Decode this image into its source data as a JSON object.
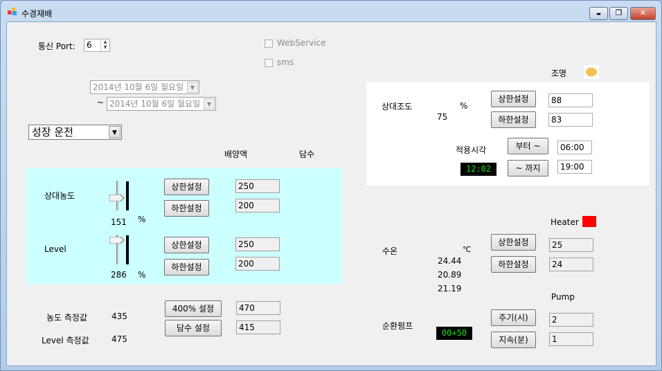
{
  "window": {
    "title": "수경재배",
    "minimize": "▬",
    "maximize": "❐",
    "close": "✕"
  },
  "comm": {
    "port_label": "통신 Port:",
    "port_value": "6"
  },
  "checks": {
    "webservice": "WebService",
    "sms": "sms"
  },
  "dates": {
    "start": "2014년 10월  6일 월요일",
    "separator": "~",
    "end": "2014년 10월  6일 월요일"
  },
  "mode": {
    "selected": "성장 운전"
  },
  "columns": {
    "nutrient": "배양액",
    "freshwater": "담수"
  },
  "concentration": {
    "label": "상대농도",
    "value": "151",
    "unit": "%",
    "upper_btn": "상한설정",
    "lower_btn": "하한설정",
    "upper_val": "250",
    "lower_val": "200"
  },
  "level": {
    "label": "Level",
    "value": "286",
    "unit": "%",
    "upper_btn": "상한설정",
    "lower_btn": "하한설정",
    "upper_val": "250",
    "lower_val": "200"
  },
  "measure": {
    "conc_label": "농도 측정값",
    "conc_value": "435",
    "level_label": "Level 측정값",
    "level_value": "475",
    "btn400": "400% 설정",
    "btn_fresh": "담수 설정",
    "val400": "470",
    "val_fresh": "415"
  },
  "lighting": {
    "title": "조명",
    "label": "상대조도",
    "unit": "%",
    "value": "75",
    "upper_btn": "상한설정",
    "lower_btn": "하한설정",
    "upper_val": "88",
    "lower_val": "83",
    "apply_label": "적용시각",
    "clock": "12:02",
    "from_btn": "부터 ~",
    "to_btn": "~ 까지",
    "from_val": "06:00",
    "to_val": "19:00",
    "indicator_color": "#f2c25a"
  },
  "water": {
    "heater_label": "Heater",
    "heater_color": "#ff0000",
    "label": "수온",
    "unit": "℃",
    "temps": [
      "24.44",
      "20.89",
      "21.19"
    ],
    "upper_btn": "상한설정",
    "lower_btn": "하한설정",
    "upper_val": "25",
    "lower_val": "24"
  },
  "pump": {
    "title": "Pump",
    "label": "순환펌프",
    "timer": "00+50",
    "cycle_btn": "주기(시)",
    "duration_btn": "지속(분)",
    "cycle_val": "2",
    "duration_val": "1"
  },
  "colors": {
    "cyan_panel": "#ccffff",
    "white_panel": "#ffffff",
    "clock_text": "#19e019"
  }
}
